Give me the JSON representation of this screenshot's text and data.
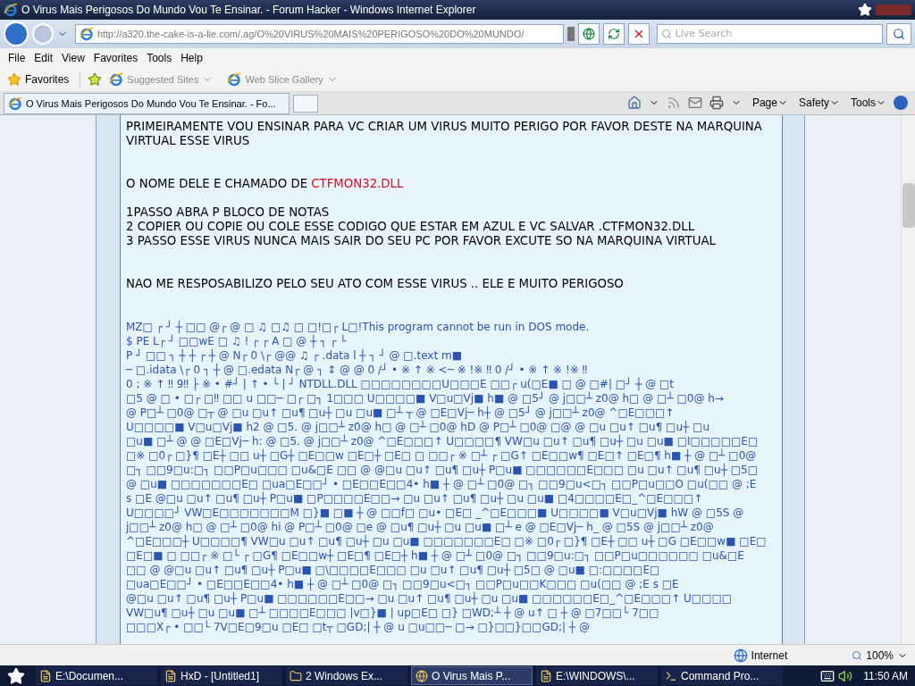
{
  "window": {
    "title": "O Virus Mais Perigosos Do Mundo Vou Te Ensinar. - Forum Hacker - Windows Internet Explorer"
  },
  "nav": {
    "address": "http://a320.the-cake-is-a-lie.com/.ag/O%20VIRUS%20MAIS%20PERIGOSO%20DO%20MUNDO/",
    "search_placeholder": "Live Search"
  },
  "menu": [
    "File",
    "Edit",
    "View",
    "Favorites",
    "Tools",
    "Help"
  ],
  "favorites_bar": {
    "label": "Favorites",
    "items": [
      "Suggested Sites",
      "Web Slice Gallery"
    ]
  },
  "tabs": [
    {
      "label": "O Virus Mais Perigosos Do Mundo Vou Te Ensinar. - Fo...",
      "selected": true
    }
  ],
  "command_bar": [
    "Page",
    "Safety",
    "Tools"
  ],
  "post": {
    "blocks": [
      {
        "kind": "text",
        "text": "PRIMEIRAMENTE VOU ENSINAR PARA VC CRIAR UM VIRUS MUITO PERIGO POR FAVOR DESTE NA MARQUINA VIRTUAL ESSE VIRUS"
      },
      {
        "kind": "name",
        "text": "O NOME DELE E CHAMADO DE",
        "value": "CTFMON32.DLL"
      },
      {
        "kind": "steps",
        "lines": [
          "1PASSO ABRA P BLOCO DE NOTAS",
          "2 COPIER OU COPIE OU COLE ESSE CODIGO QUE ESTAR EM AZUL E VC SALVAR .CTFMON32.DLL",
          "3 PASSO ESSE VIRUS NUNCA MAIS SAIR DO SEU PC POR FAVOR EXCUTE SO NA MARQUINA VIRTUAL"
        ]
      },
      {
        "kind": "text",
        "text": "NAO ME RESPOSABILIZO PELO SEU ATO COM ESSE VIRUS .. ELE E MUITO PERIGOSO"
      },
      {
        "kind": "code",
        "lines": [
          "MZ□ ┌ ┘ ┼ □□ @┌ @ □ ♫ □♫ □ □!□┌ L□!This program cannot be run in DOS mode.",
          "$ PE L┌ ┘ □□wE □ ♫ ! ┌ ┌ A □ @ ┼ ┐ ┌ └",
          "P ┘ □□ ┐ ┼ ┼ ┌ ┼ @ N┌ 0 \\┌ @@ ♫ ┌ .data l ┼ ┐ ┘ @ □.text m■",
          "─ □.idata \\┌ 0 ┐ ┼ @ □.edata N┌ @ ┐ ↕ @ @ 0 /┘ • ※ ↑ ※ <─ ※ !※ ‼ 0 /┘ • ※ ↑ ※ !※ ‼",
          "0 ; ※ ↑ ‼ 9‼ ├ ※ • #┘ | ↑ • └ | ┘ NTDLL.DLL □□□□□□□□U□□□E □□┌ u(□E■ □ @ □#| □┘ ┼ @ □t",
          "□5 @ □ • □┌ □‼ □□ u □□─ □┌ □┐ 1□□□ U□□□□■ V□u□Vj■ h■ @ □5┘ @ j□□┴ z0@ h□ @ □┴ □0@ h→",
          "@ P□┴ □0@ □┬ @ □u □u↑ □u¶ □u┼ □u □u■ □┴ ┬ @ □E□Vj─ h┼ @ □5┘ @ j□□┴ z0@ ^□E□□□↑",
          "U□□□□■ V□u□Vj■ h2 @ □5. @ j□□┴ z0@ h□ @ □┴ □0@ hD @ P□┴ □0@ □@ @ □u □u↑ □u¶ □u┼ □u",
          "□u■ □┴ @ @ □E□Vj─ h: @ □5. @ j□□┴ z0@ ^□E□□□↑ U□□□□¶ VW□u □u↑ □u¶ □u┼ □u □u■ □I□□□□□E□",
          "□※ □0┌ □}¶ □E┼ □□ u┼ □G┼ □E□□w □E□┼ □E□ □ □□┌ ※ □┴ ┌ □G↑ □E□□w¶ □E□↑ □E□¶ h■ ┼ @ □┴ □0@",
          "□┐ □□9□u:□┐ □□P□u□□□ □u&□E □□ @ @□u □u↑ □u¶ □u┼ P□u■ □□□□□□E□□□ □u □u↑ □u¶ □u┼ □5□",
          "@ □u■ □□□□□□□E□ □ua□E□□┘ • □E□□E□□4• h■ ┼ @ □┴ □0@ □┐ □□9□u<□┐ □□P□u□□O □u(□□ @ ;E",
          "s □E @□u □u↑ □u¶ □u┼ P□u■ □P□□□□E□□→ □u □u↑ □u¶ □u┼ □u □u■ □4□□□□E□_^□E□□□↑",
          "U□□□□┘ VW□E□□□□□□□M □}■ □■ ┼ @ □□f□ □u• □E□ _^□E□□□■ U□□□□■ V□u□Vj■ hW @ □5S @",
          "j□□┴ z0@ h□ @ □┴ □0@ hi @ P□┴ □0@ □e @ □u¶ □u┼ □u □u■ □┴ e @ □E□Vj─ h_ @ □5S @ j□□┴ z0@",
          "^□E□□□┼ U□□□□¶ VW□u □u↑ □u¶ □u┼ □u □u■ □□□□□□□E□ □※ □0┌ □}¶ □E┼ □□ u┼ □G □E□□w■ □E□",
          "□E□■ □ □□┌ ※ □└ ┌ □G¶ □E□□w┼ □E□¶ □E□┼ h■ ┼ @ □┴ □0@ □┐ □□9□u:□┐ □□P□u□□□□□□ □u&□E",
          "□□ @ @□u □u↑ □u¶ □u┼ P□u■ □\\□□□□E□□□ □u □u↑ □u¶ □u┼ □5□ @ □u■ □:□□□□E□",
          "□ua□E□□┘ • □E□□E□□4• h■ ┼ @ □┴ □0@ □┐ □□9□u<□┐ □□P□u□□K□□□ □u(□□ @ ;E s □E",
          "@□u □u↑ □u¶ □u┼ P□u■ □□□□□□E□□→ □u □u↑ □u¶ □u┼ □u □u■ □□□□□□E□_^□E□□□↑ U□□□□",
          "VW□u¶ □u┼ □u □u■ □┴ □□□□E□□□ |v□}■ | up□E□ □} □WD;┴ ┼ @ u↑ □ ┼ @ □7□□└ 7□□",
          "□□□X┌ • □□└ 7V□E□9□u □E□ □t┬ □GD;| ┼ @ u □u□□─ □→ □}□□}□□GD;| ┼ @"
        ]
      }
    ]
  },
  "status_bar": {
    "zone": "Internet",
    "zoom": "100%"
  },
  "taskbar": {
    "items": [
      {
        "label": "E:\\Documen...",
        "selected": false,
        "kind": "app"
      },
      {
        "label": "HxD - [Untitled1]",
        "selected": false,
        "kind": "app"
      },
      {
        "label": "2 Windows Ex...",
        "selected": false,
        "kind": "folder"
      },
      {
        "label": "O Virus Mais P...",
        "selected": true,
        "kind": "ie"
      },
      {
        "label": "E:\\WINDOWS\\...",
        "selected": false,
        "kind": "notepad"
      },
      {
        "label": "Command Pro...",
        "selected": false,
        "kind": "cmd"
      }
    ],
    "clock": "11:50 AM"
  }
}
